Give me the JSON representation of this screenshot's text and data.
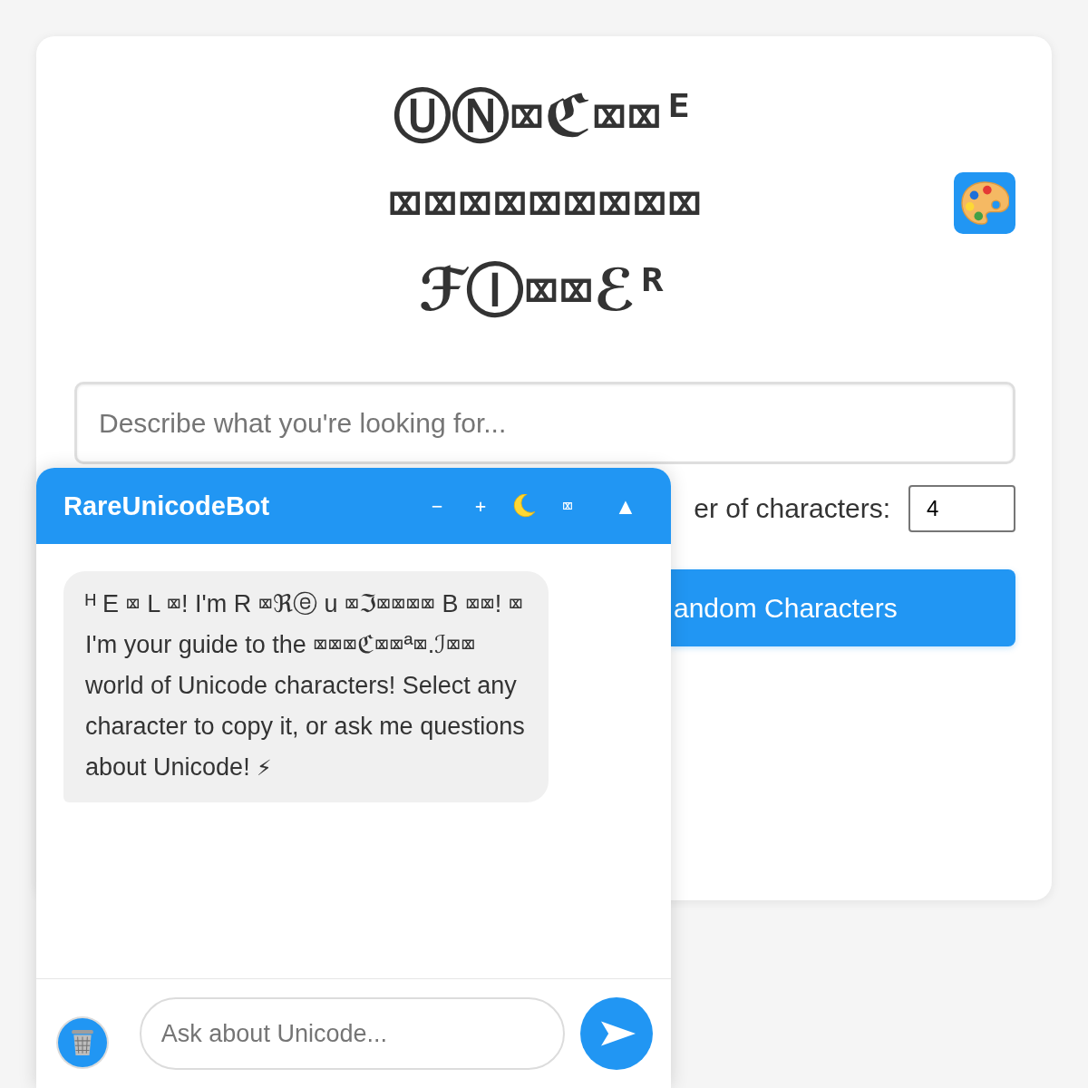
{
  "app": {
    "title": "ⓊⓃ⌧ℭ⌧⌧ᴱ ⌧⌧⌧⌧⌧⌧⌧⌧⌧ ℱⒾ⌧⌧ℰᴿ"
  },
  "search": {
    "placeholder": "Describe what you're looking for..."
  },
  "count": {
    "label": "er of characters:",
    "value": "4"
  },
  "generate_button": {
    "label": "andom Characters"
  },
  "chat": {
    "title": "RareUnicodeBot",
    "header_buttons": [
      {
        "kind": "glyph",
        "label": "−"
      },
      {
        "kind": "glyph",
        "label": "+"
      },
      {
        "kind": "theme"
      },
      {
        "kind": "glyph",
        "label": "⌧"
      },
      {
        "kind": "glyph",
        "label": "▲"
      }
    ],
    "messages": [
      {
        "text": "ᴴ E ⌧ L ⌧! I'm R ⌧ℜⓔ u ⌧ℑ⌧⌧⌧⌧ B ⌧⌧! ⌧ I'm your guide to the ⌧⌧⌧ℭ⌧⌧ª⌧.ℐ⌧⌧ world of Unicode characters! Select any character to copy it, or ask me questions about Unicode! ⚡"
      }
    ],
    "input": {
      "placeholder": "Ask about Unicode..."
    }
  }
}
